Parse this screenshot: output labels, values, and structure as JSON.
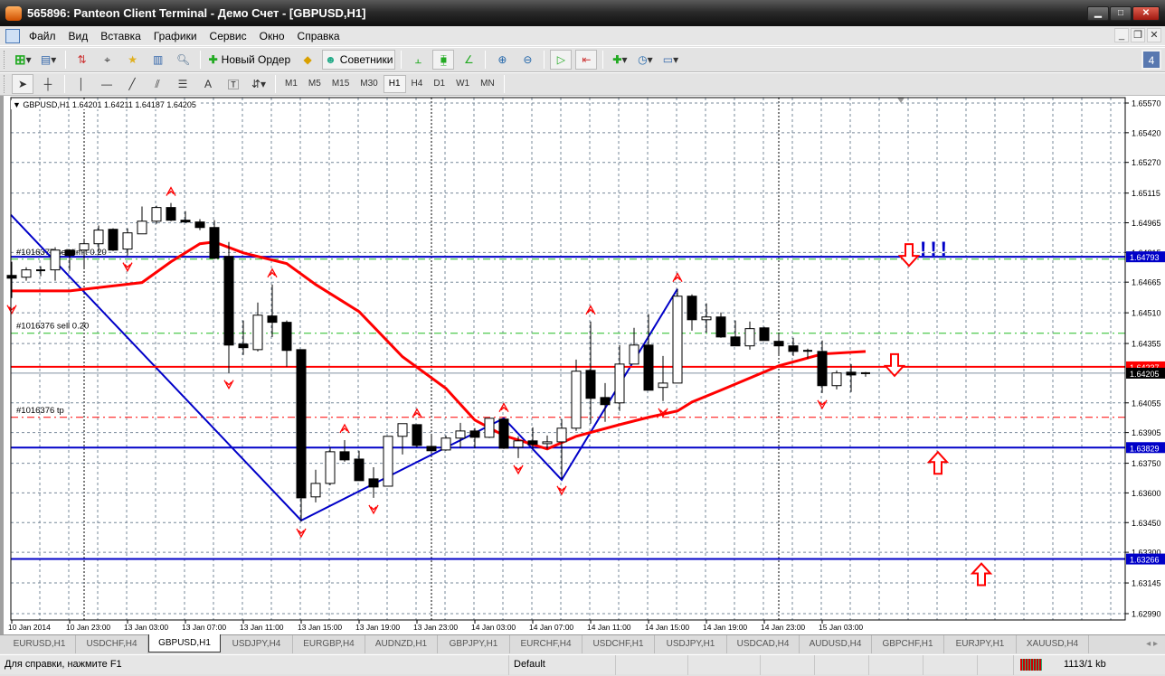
{
  "window": {
    "title": "565896: Panteon Client Terminal - Демо Счет - [GBPUSD,H1]"
  },
  "menu": [
    "Файл",
    "Вид",
    "Вставка",
    "Графики",
    "Сервис",
    "Окно",
    "Справка"
  ],
  "toolbar": {
    "new_order": "Новый Ордер",
    "experts": "Советники",
    "notifications_count": "4"
  },
  "timeframes": [
    "M1",
    "M5",
    "M15",
    "M30",
    "H1",
    "H4",
    "D1",
    "W1",
    "MN"
  ],
  "active_timeframe": "H1",
  "chart_data": {
    "type": "candlestick",
    "header": "GBPUSD,H1  1.64201 1.64211 1.64187 1.64205",
    "symbol": "GBPUSD,H1",
    "ylim": [
      1.6299,
      1.6557
    ],
    "y_ticks": [
      "1.65570",
      "1.65420",
      "1.65270",
      "1.65115",
      "1.64965",
      "1.64815",
      "1.64665",
      "1.64510",
      "1.64355",
      "1.64055",
      "1.63905",
      "1.63750",
      "1.63600",
      "1.63450",
      "1.63300",
      "1.63145",
      "1.62990"
    ],
    "x_labels": [
      "10 Jan 2014",
      "10 Jan 23:00",
      "13 Jan 03:00",
      "13 Jan 07:00",
      "13 Jan 11:00",
      "13 Jan 15:00",
      "13 Jan 19:00",
      "13 Jan 23:00",
      "14 Jan 03:00",
      "14 Jan 07:00",
      "14 Jan 11:00",
      "14 Jan 15:00",
      "14 Jan 19:00",
      "14 Jan 23:00",
      "15 Jan 03:00"
    ],
    "bars_per_label": 4,
    "day_separators": [
      5,
      29,
      53
    ],
    "candles_ohlc": [
      [
        1.64699,
        1.64768,
        1.64585,
        1.64685
      ],
      [
        1.6469,
        1.6474,
        1.64672,
        1.64727
      ],
      [
        1.64725,
        1.64745,
        1.64695,
        1.64722
      ],
      [
        1.64727,
        1.64841,
        1.64672,
        1.64827
      ],
      [
        1.64827,
        1.6483,
        1.64722,
        1.648
      ],
      [
        1.64827,
        1.64882,
        1.64736,
        1.64859
      ],
      [
        1.64859,
        1.64951,
        1.64818,
        1.64928
      ],
      [
        1.64932,
        1.64937,
        1.64822,
        1.64827
      ],
      [
        1.64832,
        1.64937,
        1.648,
        1.64914
      ],
      [
        1.64909,
        1.65047,
        1.64909,
        1.64973
      ],
      [
        1.64973,
        1.65051,
        1.6496,
        1.65042
      ],
      [
        1.65042,
        1.65065,
        1.64973,
        1.64978
      ],
      [
        1.64978,
        1.65024,
        1.64964,
        1.64969
      ],
      [
        1.64969,
        1.64983,
        1.64928,
        1.64941
      ],
      [
        1.64941,
        1.64978,
        1.64781,
        1.64786
      ],
      [
        1.64795,
        1.64868,
        1.64206,
        1.64347
      ],
      [
        1.64352,
        1.64471,
        1.64297,
        1.64334
      ],
      [
        1.64324,
        1.64562,
        1.64315,
        1.64498
      ],
      [
        1.64494,
        1.64653,
        1.64388,
        1.64462
      ],
      [
        1.64462,
        1.64471,
        1.64238,
        1.6432
      ],
      [
        1.64324,
        1.64324,
        1.63456,
        1.63575
      ],
      [
        1.6358,
        1.63717,
        1.63552,
        1.63648
      ],
      [
        1.63648,
        1.63831,
        1.63639,
        1.63808
      ],
      [
        1.63808,
        1.63867,
        1.63758,
        1.63767
      ],
      [
        1.63771,
        1.63813,
        1.63662,
        1.63662
      ],
      [
        1.63671,
        1.6373,
        1.63575,
        1.6363
      ],
      [
        1.63634,
        1.63886,
        1.63634,
        1.63886
      ],
      [
        1.63886,
        1.6395,
        1.63794,
        1.6395
      ],
      [
        1.63945,
        1.63945,
        1.63831,
        1.6384
      ],
      [
        1.63835,
        1.6389,
        1.63808,
        1.63813
      ],
      [
        1.63817,
        1.6389,
        1.63813,
        1.63877
      ],
      [
        1.63877,
        1.63954,
        1.63826,
        1.63913
      ],
      [
        1.63913,
        1.63927,
        1.63826,
        1.63881
      ],
      [
        1.63881,
        1.63977,
        1.63877,
        1.63977
      ],
      [
        1.63973,
        1.63973,
        1.63822,
        1.63826
      ],
      [
        1.63831,
        1.63886,
        1.63776,
        1.63863
      ],
      [
        1.63863,
        1.63931,
        1.63822,
        1.63845
      ],
      [
        1.63849,
        1.6389,
        1.63822,
        1.63858
      ],
      [
        1.63858,
        1.63973,
        1.63671,
        1.63927
      ],
      [
        1.63927,
        1.64274,
        1.63913,
        1.64215
      ],
      [
        1.64219,
        1.64466,
        1.6395,
        1.64078
      ],
      [
        1.64082,
        1.64155,
        1.63959,
        1.64046
      ],
      [
        1.64055,
        1.64347,
        1.64014,
        1.64251
      ],
      [
        1.64251,
        1.64434,
        1.64251,
        1.64347
      ],
      [
        1.64347,
        1.64503,
        1.64119,
        1.64119
      ],
      [
        1.64133,
        1.64292,
        1.64064,
        1.64155
      ],
      [
        1.64155,
        1.64631,
        1.64155,
        1.64594
      ],
      [
        1.64594,
        1.64603,
        1.6442,
        1.64475
      ],
      [
        1.64475,
        1.64558,
        1.64411,
        1.64489
      ],
      [
        1.64489,
        1.64512,
        1.64384,
        1.64388
      ],
      [
        1.64388,
        1.64471,
        1.64343,
        1.64343
      ],
      [
        1.64343,
        1.64466,
        1.64324,
        1.6443
      ],
      [
        1.64434,
        1.64439,
        1.6437,
        1.6437
      ],
      [
        1.64366,
        1.64411,
        1.64297,
        1.64343
      ],
      [
        1.64343,
        1.64384,
        1.64292,
        1.64315
      ],
      [
        1.64315,
        1.64329,
        1.64279,
        1.64318
      ],
      [
        1.64315,
        1.6437,
        1.64105,
        1.64142
      ],
      [
        1.64142,
        1.64219,
        1.64123,
        1.64206
      ],
      [
        1.6421,
        1.64251,
        1.6411,
        1.64196
      ],
      [
        1.64201,
        1.64211,
        1.64187,
        1.64205
      ]
    ],
    "moving_average": [
      [
        0,
        1.64621
      ],
      [
        4,
        1.64621
      ],
      [
        9,
        1.64663
      ],
      [
        11,
        1.64768
      ],
      [
        13,
        1.64859
      ],
      [
        14,
        1.64868
      ],
      [
        16,
        1.64813
      ],
      [
        19,
        1.64759
      ],
      [
        21,
        1.64653
      ],
      [
        24,
        1.64516
      ],
      [
        27,
        1.64288
      ],
      [
        30,
        1.64128
      ],
      [
        32,
        1.63968
      ],
      [
        34,
        1.6389
      ],
      [
        37,
        1.63822
      ],
      [
        39,
        1.63886
      ],
      [
        42,
        1.63945
      ],
      [
        44,
        1.63982
      ],
      [
        46,
        1.64014
      ],
      [
        47,
        1.64059
      ],
      [
        49,
        1.64119
      ],
      [
        53,
        1.64242
      ],
      [
        56,
        1.64302
      ],
      [
        59,
        1.64315
      ]
    ],
    "zigzag": [
      [
        0,
        1.65005
      ],
      [
        20,
        1.63461
      ],
      [
        34,
        1.63977
      ],
      [
        38,
        1.63666
      ],
      [
        46,
        1.64631
      ]
    ],
    "fractals_up": [
      11,
      18,
      23,
      28,
      34,
      40,
      46
    ],
    "fractals_down": [
      0,
      8,
      15,
      20,
      25,
      35,
      38,
      45,
      56
    ],
    "hlines": [
      {
        "price": 1.64793,
        "label": "1.64793",
        "color": "#0000c8"
      },
      {
        "price": 1.64237,
        "label": "1.64237",
        "color": "#ff0000"
      },
      {
        "price": 1.63829,
        "label": "1.63829",
        "color": "#0000c8"
      },
      {
        "price": 1.63266,
        "label": "1.63266",
        "color": "#0000c8"
      }
    ],
    "bid": {
      "price": 1.64205,
      "label": "1.64205"
    },
    "orders": [
      {
        "price": 1.64781,
        "text": "#1016377 sell limit 0.20",
        "color": "#22bb22"
      },
      {
        "price": 1.64407,
        "text": "#1016376 sell 0.20",
        "color": "#22bb22"
      },
      {
        "price": 1.63982,
        "text": "#1016376 tp",
        "color": "#ff0000"
      }
    ],
    "signal_arrows": [
      {
        "bar": 62,
        "price": 1.64793,
        "dir": "down"
      },
      {
        "bar": 61,
        "price": 1.64237,
        "dir": "down"
      },
      {
        "bar": 64,
        "price": 1.63829,
        "dir": "up"
      },
      {
        "bar": 67,
        "price": 1.63266,
        "dir": "up"
      }
    ],
    "alert_text": {
      "bar": 63.5,
      "price": 1.64793,
      "text": "!!!"
    },
    "colors": {
      "bull": "#ffffff",
      "bear": "#000000",
      "ma": "#ff0000",
      "zigzag": "#0000c8",
      "fractal": "#ff0000",
      "grid": "#778899"
    }
  },
  "tabs": [
    "EURUSD,H1",
    "USDCHF,H4",
    "GBPUSD,H1",
    "USDJPY,H4",
    "EURGBP,H4",
    "AUDNZD,H1",
    "GBPJPY,H1",
    "EURCHF,H4",
    "USDCHF,H1",
    "USDJPY,H1",
    "USDCAD,H4",
    "AUDUSD,H4",
    "GBPCHF,H1",
    "EURJPY,H1",
    "XAUUSD,H4"
  ],
  "active_tab": "GBPUSD,H1",
  "status": {
    "help": "Для справки, нажмите F1",
    "profile": "Default",
    "traffic": "1113/1 kb"
  }
}
